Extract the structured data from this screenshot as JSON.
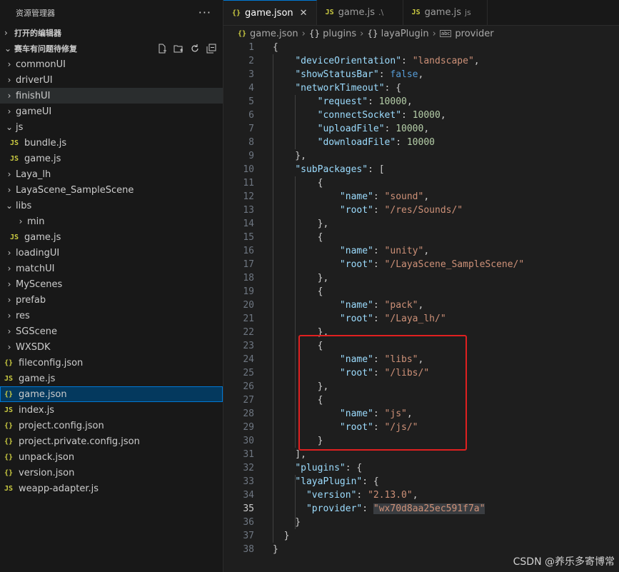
{
  "explorer": {
    "title": "资源管理器",
    "more": "···",
    "open_editors": "打开的编辑器",
    "project": "赛车有问题待修复",
    "actions": [
      "new-file",
      "new-folder",
      "refresh",
      "collapse"
    ],
    "items": [
      {
        "label": "commonUI",
        "kind": "folder",
        "open": false
      },
      {
        "label": "driverUI",
        "kind": "folder",
        "open": false
      },
      {
        "label": "finishUI",
        "kind": "folder",
        "open": false
      },
      {
        "label": "gameUI",
        "kind": "folder",
        "open": false
      },
      {
        "label": "js",
        "kind": "folder",
        "open": true
      },
      {
        "label": "bundle.js",
        "kind": "js"
      },
      {
        "label": "game.js",
        "kind": "js"
      },
      {
        "label": "Laya_lh",
        "kind": "folder",
        "open": false
      },
      {
        "label": "LayaScene_SampleScene",
        "kind": "folder",
        "open": false
      },
      {
        "label": "libs",
        "kind": "folder",
        "open": true
      },
      {
        "label": "min",
        "kind": "folder",
        "open": false
      },
      {
        "label": "game.js",
        "kind": "js"
      },
      {
        "label": "loadingUI",
        "kind": "folder",
        "open": false
      },
      {
        "label": "matchUI",
        "kind": "folder",
        "open": false
      },
      {
        "label": "MyScenes",
        "kind": "folder",
        "open": false
      },
      {
        "label": "prefab",
        "kind": "folder",
        "open": false
      },
      {
        "label": "res",
        "kind": "folder",
        "open": false
      },
      {
        "label": "SGScene",
        "kind": "folder",
        "open": false
      },
      {
        "label": "WXSDK",
        "kind": "folder",
        "open": false
      },
      {
        "label": "fileconfig.json",
        "kind": "json"
      },
      {
        "label": "game.js",
        "kind": "js"
      },
      {
        "label": "game.json",
        "kind": "json",
        "selected": true
      },
      {
        "label": "index.js",
        "kind": "js"
      },
      {
        "label": "project.config.json",
        "kind": "json"
      },
      {
        "label": "project.private.config.json",
        "kind": "json"
      },
      {
        "label": "unpack.json",
        "kind": "json"
      },
      {
        "label": "version.json",
        "kind": "json"
      },
      {
        "label": "weapp-adapter.js",
        "kind": "js"
      }
    ]
  },
  "tabs": [
    {
      "label": "game.json",
      "icon": "{}",
      "desc": "",
      "active": true,
      "close": "✕"
    },
    {
      "label": "game.js",
      "icon": "JS",
      "desc": ".\\",
      "active": false
    },
    {
      "label": "game.js",
      "icon": "JS",
      "desc": "js",
      "active": false
    }
  ],
  "breadcrumb": [
    "game.json",
    "plugins",
    "layaPlugin",
    "provider"
  ],
  "editor": {
    "current_line": 35,
    "lines": [
      [
        [
          "p",
          "{"
        ]
      ],
      [
        [
          "p",
          "    "
        ],
        [
          "k",
          "\"deviceOrientation\""
        ],
        [
          "p",
          ": "
        ],
        [
          "s",
          "\"landscape\""
        ],
        [
          "p",
          ","
        ]
      ],
      [
        [
          "p",
          "    "
        ],
        [
          "k",
          "\"showStatusBar\""
        ],
        [
          "p",
          ": "
        ],
        [
          "b",
          "false"
        ],
        [
          "p",
          ","
        ]
      ],
      [
        [
          "p",
          "    "
        ],
        [
          "k",
          "\"networkTimeout\""
        ],
        [
          "p",
          ": {"
        ]
      ],
      [
        [
          "p",
          "        "
        ],
        [
          "k",
          "\"request\""
        ],
        [
          "p",
          ": "
        ],
        [
          "n",
          "10000"
        ],
        [
          "p",
          ","
        ]
      ],
      [
        [
          "p",
          "        "
        ],
        [
          "k",
          "\"connectSocket\""
        ],
        [
          "p",
          ": "
        ],
        [
          "n",
          "10000"
        ],
        [
          "p",
          ","
        ]
      ],
      [
        [
          "p",
          "        "
        ],
        [
          "k",
          "\"uploadFile\""
        ],
        [
          "p",
          ": "
        ],
        [
          "n",
          "10000"
        ],
        [
          "p",
          ","
        ]
      ],
      [
        [
          "p",
          "        "
        ],
        [
          "k",
          "\"downloadFile\""
        ],
        [
          "p",
          ": "
        ],
        [
          "n",
          "10000"
        ]
      ],
      [
        [
          "p",
          "    },"
        ]
      ],
      [
        [
          "p",
          "    "
        ],
        [
          "k",
          "\"subPackages\""
        ],
        [
          "p",
          ": ["
        ]
      ],
      [
        [
          "p",
          "        {"
        ]
      ],
      [
        [
          "p",
          "            "
        ],
        [
          "k",
          "\"name\""
        ],
        [
          "p",
          ": "
        ],
        [
          "s",
          "\"sound\""
        ],
        [
          "p",
          ","
        ]
      ],
      [
        [
          "p",
          "            "
        ],
        [
          "k",
          "\"root\""
        ],
        [
          "p",
          ": "
        ],
        [
          "s",
          "\"/res/Sounds/\""
        ]
      ],
      [
        [
          "p",
          "        },"
        ]
      ],
      [
        [
          "p",
          "        {"
        ]
      ],
      [
        [
          "p",
          "            "
        ],
        [
          "k",
          "\"name\""
        ],
        [
          "p",
          ": "
        ],
        [
          "s",
          "\"unity\""
        ],
        [
          "p",
          ","
        ]
      ],
      [
        [
          "p",
          "            "
        ],
        [
          "k",
          "\"root\""
        ],
        [
          "p",
          ": "
        ],
        [
          "s",
          "\"/LayaScene_SampleScene/\""
        ]
      ],
      [
        [
          "p",
          "        },"
        ]
      ],
      [
        [
          "p",
          "        {"
        ]
      ],
      [
        [
          "p",
          "            "
        ],
        [
          "k",
          "\"name\""
        ],
        [
          "p",
          ": "
        ],
        [
          "s",
          "\"pack\""
        ],
        [
          "p",
          ","
        ]
      ],
      [
        [
          "p",
          "            "
        ],
        [
          "k",
          "\"root\""
        ],
        [
          "p",
          ": "
        ],
        [
          "s",
          "\"/Laya_lh/\""
        ]
      ],
      [
        [
          "p",
          "        },"
        ]
      ],
      [
        [
          "p",
          "        {"
        ]
      ],
      [
        [
          "p",
          "            "
        ],
        [
          "k",
          "\"name\""
        ],
        [
          "p",
          ": "
        ],
        [
          "s",
          "\"libs\""
        ],
        [
          "p",
          ","
        ]
      ],
      [
        [
          "p",
          "            "
        ],
        [
          "k",
          "\"root\""
        ],
        [
          "p",
          ": "
        ],
        [
          "s",
          "\"/libs/\""
        ]
      ],
      [
        [
          "p",
          "        },"
        ]
      ],
      [
        [
          "p",
          "        {"
        ]
      ],
      [
        [
          "p",
          "            "
        ],
        [
          "k",
          "\"name\""
        ],
        [
          "p",
          ": "
        ],
        [
          "s",
          "\"js\""
        ],
        [
          "p",
          ","
        ]
      ],
      [
        [
          "p",
          "            "
        ],
        [
          "k",
          "\"root\""
        ],
        [
          "p",
          ": "
        ],
        [
          "s",
          "\"/js/\""
        ]
      ],
      [
        [
          "p",
          "        }"
        ]
      ],
      [
        [
          "p",
          "    ],"
        ]
      ],
      [
        [
          "p",
          "    "
        ],
        [
          "k",
          "\"plugins\""
        ],
        [
          "p",
          ": {"
        ]
      ],
      [
        [
          "p",
          "    "
        ],
        [
          "k",
          "\"layaPlugin\""
        ],
        [
          "p",
          ": {"
        ]
      ],
      [
        [
          "p",
          "      "
        ],
        [
          "k",
          "\"version\""
        ],
        [
          "p",
          ": "
        ],
        [
          "s",
          "\"2.13.0\""
        ],
        [
          "p",
          ","
        ]
      ],
      [
        [
          "p",
          "      "
        ],
        [
          "k",
          "\"provider\""
        ],
        [
          "p",
          ": "
        ],
        [
          "s",
          "\"wx70d8aa25ec591f7a\"",
          "hl"
        ]
      ],
      [
        [
          "p",
          "    }"
        ]
      ],
      [
        [
          "p",
          "  }"
        ]
      ],
      [
        [
          "p",
          "}"
        ]
      ]
    ]
  },
  "watermark": "CSDN @养乐多寄博常"
}
